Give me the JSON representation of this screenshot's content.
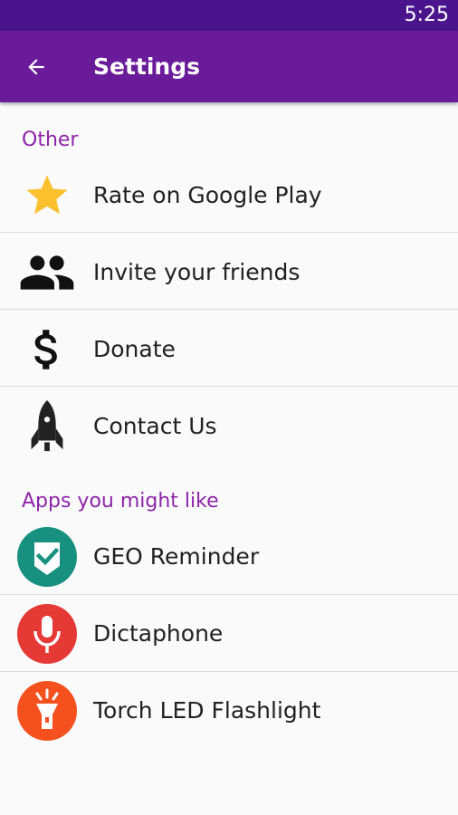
{
  "status_bar": {
    "time": "5:25"
  },
  "app_bar": {
    "title": "Settings",
    "back_icon": "arrow-back-icon"
  },
  "sections": [
    {
      "header": "Other",
      "items": [
        {
          "label": "Rate on Google Play",
          "icon": "star-icon"
        },
        {
          "label": "Invite your friends",
          "icon": "people-icon"
        },
        {
          "label": "Donate",
          "icon": "dollar-icon"
        },
        {
          "label": "Contact Us",
          "icon": "rocket-icon"
        }
      ]
    },
    {
      "header": "Apps you might like",
      "items": [
        {
          "label": "GEO Reminder",
          "icon": "geo-reminder-app-icon"
        },
        {
          "label": "Dictaphone",
          "icon": "dictaphone-app-icon"
        },
        {
          "label": "Torch LED Flashlight",
          "icon": "torch-flashlight-app-icon"
        }
      ]
    }
  ],
  "colors": {
    "status_bar": "#4a148c",
    "app_bar": "#6a1b9a",
    "section_header": "#8e24aa",
    "star": "#fbc02d",
    "geo_reminder": "#18907f",
    "dictaphone": "#e53935",
    "torch": "#f4511e"
  }
}
